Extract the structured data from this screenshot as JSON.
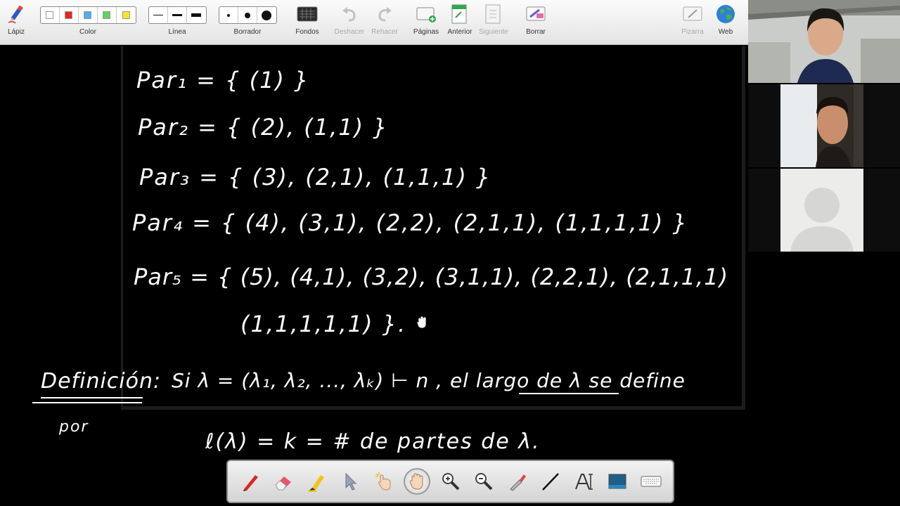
{
  "toolbar": {
    "items": [
      {
        "label": "Lápiz",
        "icon": "pencil-icon"
      },
      {
        "label": "Color",
        "icon": "color-palette"
      },
      {
        "label": "Línea",
        "icon": "line-width"
      },
      {
        "label": "Borrador",
        "icon": "eraser-size"
      },
      {
        "label": "Fondos",
        "icon": "backgrounds-icon"
      },
      {
        "label": "Deshacer",
        "icon": "undo-icon"
      },
      {
        "label": "Rehacer",
        "icon": "redo-icon"
      },
      {
        "label": "Páginas",
        "icon": "pages-icon"
      },
      {
        "label": "Anterior",
        "icon": "previous-page-icon"
      },
      {
        "label": "Siguiente",
        "icon": "next-page-icon"
      },
      {
        "label": "Borrar",
        "icon": "clear-icon"
      },
      {
        "label": "Pizarra",
        "icon": "whiteboard-icon"
      },
      {
        "label": "Web",
        "icon": "globe-icon"
      }
    ],
    "colors": [
      "#ffffff",
      "#e8261a",
      "#4ab0f0",
      "#5fd35f",
      "#f5e52a"
    ],
    "disabled_color": "#a8a8a8"
  },
  "board": {
    "lines": [
      "Par₁ = { (1) }",
      "Par₂ = { (2), (1,1) }",
      "Par₃ = { (3), (2,1), (1,1,1) }",
      "Par₄ = { (4), (3,1), (2,2), (2,1,1), (1,1,1,1) }",
      "Par₅ = { (5), (4,1), (3,2), (3,1,1), (2,2,1), (2,1,1,1)",
      "(1,1,1,1,1) }."
    ],
    "definition_label": "Definición:",
    "definition_text": "Si λ = (λ₁, λ₂, ..., λₖ) ⊢ n , el largo de λ se define",
    "por": "por",
    "formula": "ℓ(λ) = k = # de partes de λ."
  },
  "bottom_tools": [
    {
      "icon": "red-pen-icon"
    },
    {
      "icon": "eraser-icon"
    },
    {
      "icon": "highlighter-icon"
    },
    {
      "icon": "select-arrow-icon"
    },
    {
      "icon": "laser-pointer-icon"
    },
    {
      "icon": "pan-hand-icon",
      "active": true
    },
    {
      "icon": "zoom-in-icon"
    },
    {
      "icon": "zoom-out-icon"
    },
    {
      "icon": "dropper-icon"
    },
    {
      "icon": "line-tool-icon"
    },
    {
      "icon": "text-tool-icon"
    },
    {
      "icon": "image-tool-icon"
    },
    {
      "icon": "keyboard-icon"
    }
  ],
  "participants": [
    {
      "tile": "participant-video-1"
    },
    {
      "tile": "participant-video-2"
    },
    {
      "tile": "participant-avatar-3"
    }
  ],
  "ui_colors": {
    "toolbar_bg": "#ececec",
    "board_bg": "#000000",
    "ink": "#ffffff"
  }
}
